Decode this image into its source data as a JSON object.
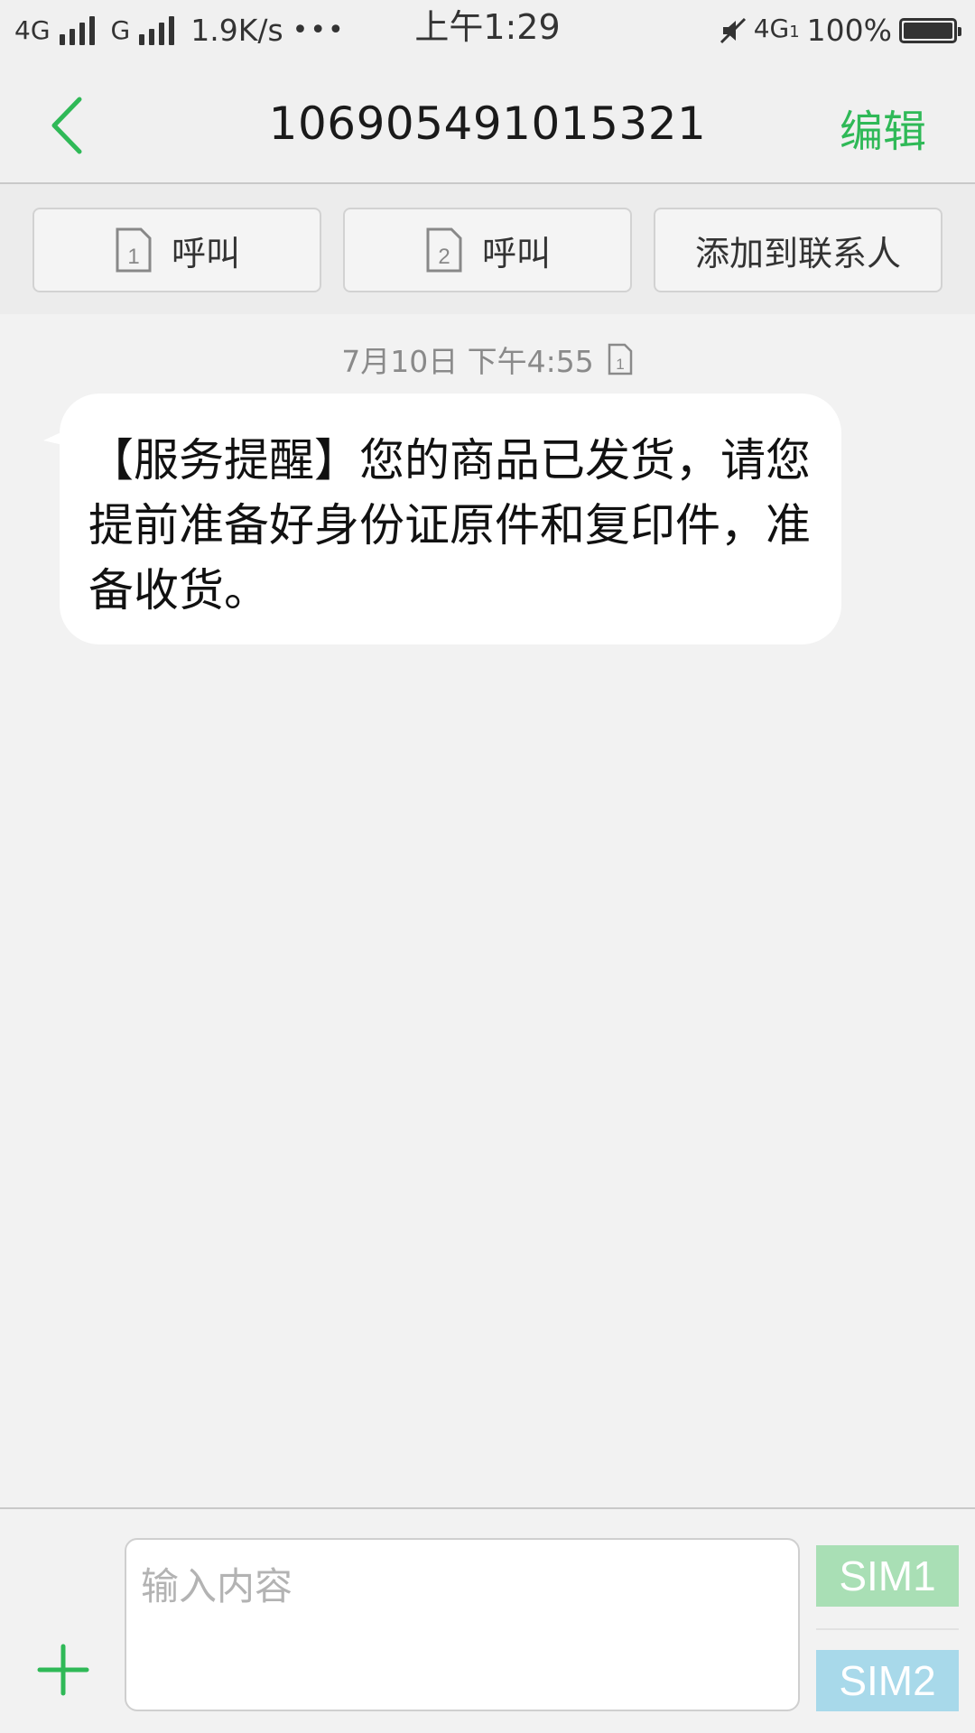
{
  "status_bar": {
    "network1": "4G",
    "network2": "G",
    "speed": "1.9K/s",
    "more": "•••",
    "time": "上午1:29",
    "lte": "4G",
    "lte_sim": "1",
    "battery": "100%"
  },
  "header": {
    "title": "106905491015321",
    "edit_label": "编辑"
  },
  "actions": {
    "call_sim1_num": "1",
    "call_sim1_label": "呼叫",
    "call_sim2_num": "2",
    "call_sim2_label": "呼叫",
    "add_contact_label": "添加到联系人"
  },
  "conversation": {
    "messages": [
      {
        "time": "7月10日 下午4:55",
        "sim": "1",
        "text": "【服务提醒】您的商品已发货，请您提前准备好身份证原件和复印件，准备收货。"
      }
    ]
  },
  "composer": {
    "placeholder": "输入内容",
    "sim1_label": "SIM1",
    "sim2_label": "SIM2"
  },
  "colors": {
    "accent_green": "#2fb957",
    "sim1_button": "#a9dfb5",
    "sim2_button": "#a8d9ea"
  }
}
